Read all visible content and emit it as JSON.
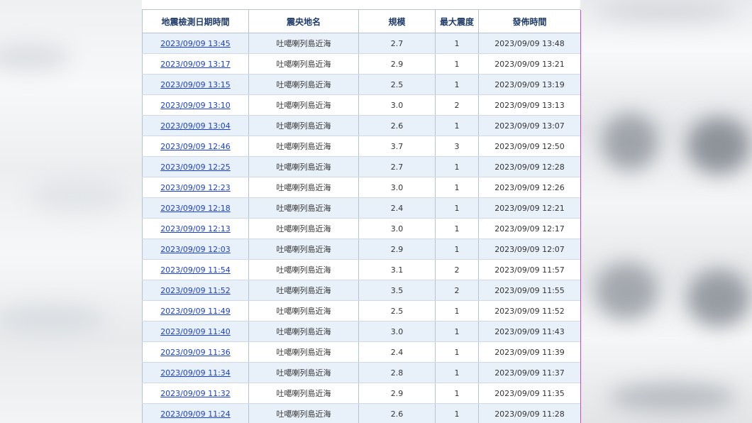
{
  "table": {
    "headers": [
      "地震檢測日期時間",
      "震央地名",
      "規模",
      "最大震度",
      "發佈時間"
    ],
    "rows": [
      {
        "time": "2023/09/09 13:45",
        "location": "吐噶喇列島近海",
        "magnitude": "2.7",
        "intensity": "1",
        "published": "2023/09/09 13:48"
      },
      {
        "time": "2023/09/09 13:17",
        "location": "吐噶喇列島近海",
        "magnitude": "2.9",
        "intensity": "1",
        "published": "2023/09/09 13:21"
      },
      {
        "time": "2023/09/09 13:15",
        "location": "吐噶喇列島近海",
        "magnitude": "2.5",
        "intensity": "1",
        "published": "2023/09/09 13:19"
      },
      {
        "time": "2023/09/09 13:10",
        "location": "吐噶喇列島近海",
        "magnitude": "3.0",
        "intensity": "2",
        "published": "2023/09/09 13:13"
      },
      {
        "time": "2023/09/09 13:04",
        "location": "吐噶喇列島近海",
        "magnitude": "2.6",
        "intensity": "1",
        "published": "2023/09/09 13:07"
      },
      {
        "time": "2023/09/09 12:46",
        "location": "吐噶喇列島近海",
        "magnitude": "3.7",
        "intensity": "3",
        "published": "2023/09/09 12:50"
      },
      {
        "time": "2023/09/09 12:25",
        "location": "吐噶喇列島近海",
        "magnitude": "2.7",
        "intensity": "1",
        "published": "2023/09/09 12:28"
      },
      {
        "time": "2023/09/09 12:23",
        "location": "吐噶喇列島近海",
        "magnitude": "3.0",
        "intensity": "1",
        "published": "2023/09/09 12:26"
      },
      {
        "time": "2023/09/09 12:18",
        "location": "吐噶喇列島近海",
        "magnitude": "2.4",
        "intensity": "1",
        "published": "2023/09/09 12:21"
      },
      {
        "time": "2023/09/09 12:13",
        "location": "吐噶喇列島近海",
        "magnitude": "3.0",
        "intensity": "1",
        "published": "2023/09/09 12:17"
      },
      {
        "time": "2023/09/09 12:03",
        "location": "吐噶喇列島近海",
        "magnitude": "2.9",
        "intensity": "1",
        "published": "2023/09/09 12:07"
      },
      {
        "time": "2023/09/09 11:54",
        "location": "吐噶喇列島近海",
        "magnitude": "3.1",
        "intensity": "2",
        "published": "2023/09/09 11:57"
      },
      {
        "time": "2023/09/09 11:52",
        "location": "吐噶喇列島近海",
        "magnitude": "3.5",
        "intensity": "2",
        "published": "2023/09/09 11:55"
      },
      {
        "time": "2023/09/09 11:49",
        "location": "吐噶喇列島近海",
        "magnitude": "2.5",
        "intensity": "1",
        "published": "2023/09/09 11:52"
      },
      {
        "time": "2023/09/09 11:40",
        "location": "吐噶喇列島近海",
        "magnitude": "3.0",
        "intensity": "1",
        "published": "2023/09/09 11:43"
      },
      {
        "time": "2023/09/09 11:36",
        "location": "吐噶喇列島近海",
        "magnitude": "2.4",
        "intensity": "1",
        "published": "2023/09/09 11:39"
      },
      {
        "time": "2023/09/09 11:34",
        "location": "吐噶喇列島近海",
        "magnitude": "2.8",
        "intensity": "1",
        "published": "2023/09/09 11:37"
      },
      {
        "time": "2023/09/09 11:32",
        "location": "吐噶喇列島近海",
        "magnitude": "2.9",
        "intensity": "1",
        "published": "2023/09/09 11:35"
      },
      {
        "time": "2023/09/09 11:24",
        "location": "吐噶喇列島近海",
        "magnitude": "2.6",
        "intensity": "1",
        "published": "2023/09/09 11:28"
      }
    ]
  },
  "colors": {
    "header_text": "#1f3b6a",
    "link": "#1a3fd6",
    "row_stripe": "#e8f1fa",
    "border": "#b8c2cf",
    "accent_edge": "#c44ad0"
  }
}
